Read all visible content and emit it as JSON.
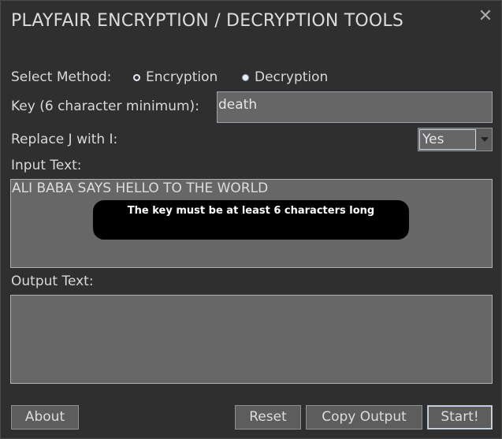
{
  "window": {
    "title": "PLAYFAIR ENCRYPTION / DECRYPTION TOOLS",
    "close_icon": "close-icon"
  },
  "method": {
    "label": "Select Method:",
    "options": [
      {
        "label": "Encryption",
        "selected": true
      },
      {
        "label": "Decryption",
        "selected": false
      }
    ]
  },
  "key": {
    "label": "Key (6 character minimum):",
    "value": "death"
  },
  "replace": {
    "label": "Replace J with I:",
    "selected": "Yes"
  },
  "input": {
    "label": "Input Text:",
    "value": "ALI BABA SAYS HELLO TO THE WORLD"
  },
  "toast": {
    "message": "The key must be at least 6 characters long"
  },
  "output": {
    "label": "Output Text:",
    "value": ""
  },
  "buttons": {
    "about": "About",
    "reset": "Reset",
    "copy": "Copy Output",
    "start": "Start!"
  }
}
